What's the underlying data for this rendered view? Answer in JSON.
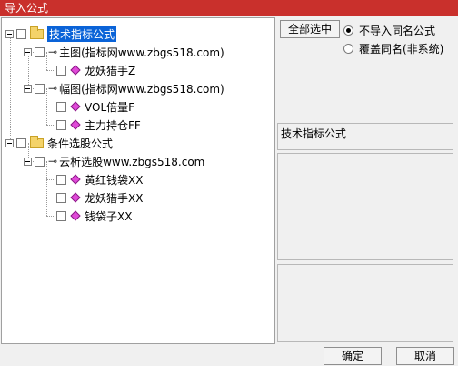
{
  "window": {
    "title": "导入公式"
  },
  "tree": {
    "root1": "技术指标公式",
    "main_group": "主图(指标网www.zbgs518.com)",
    "main_item": "龙妖猎手Z",
    "sub_group": "幅图(指标网www.zbgs518.com)",
    "sub_items": [
      "VOL倍量F",
      "主力持仓FF"
    ],
    "root2": "条件选股公式",
    "select_group": "云析选股www.zbgs518.com",
    "select_items": [
      "黄红钱袋XX",
      "龙妖猎手XX",
      "钱袋子XX"
    ]
  },
  "options": {
    "select_all": "全部选中",
    "radio_no_import": "不导入同名公式",
    "radio_overwrite": "覆盖同名(非系统)",
    "selected_radio": "不导入同名公式"
  },
  "info": {
    "label": "技术指标公式"
  },
  "footer": {
    "ok": "确定",
    "cancel": "取消"
  }
}
